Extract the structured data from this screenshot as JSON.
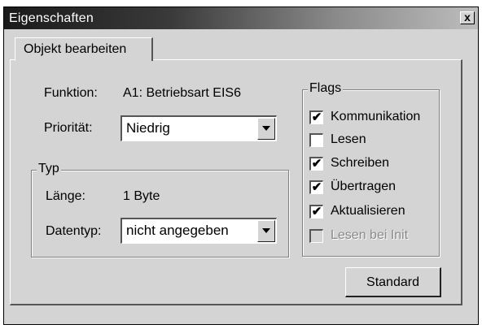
{
  "window": {
    "title": "Eigenschaften",
    "close_label": "x"
  },
  "tab": {
    "label": "Objekt bearbeiten"
  },
  "funktion": {
    "label": "Funktion:",
    "value": "A1: Betriebsart EIS6"
  },
  "prioritaet": {
    "label": "Priorität:",
    "selected": "Niedrig"
  },
  "typ": {
    "legend": "Typ",
    "laenge_label": "Länge:",
    "laenge_value": "1 Byte",
    "datentyp_label": "Datentyp:",
    "datentyp_selected": "nicht angegeben"
  },
  "flags": {
    "legend": "Flags",
    "items": [
      {
        "label": "Kommunikation",
        "checked": true,
        "enabled": true
      },
      {
        "label": "Lesen",
        "checked": false,
        "enabled": true
      },
      {
        "label": "Schreiben",
        "checked": true,
        "enabled": true
      },
      {
        "label": "Übertragen",
        "checked": true,
        "enabled": true
      },
      {
        "label": "Aktualisieren",
        "checked": true,
        "enabled": true
      },
      {
        "label": "Lesen bei Init",
        "checked": false,
        "enabled": false
      }
    ]
  },
  "buttons": {
    "standard_label": "Standard"
  }
}
